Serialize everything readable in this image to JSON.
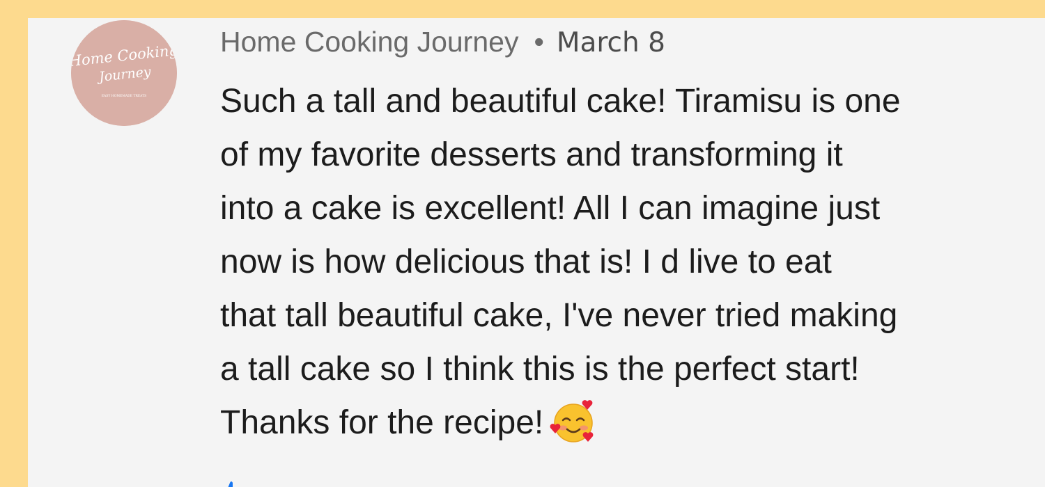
{
  "comment": {
    "author": "Home Cooking Journey",
    "separator": "•",
    "date": "March 8",
    "text_before_emoji": "Such a tall and beautiful cake! Tiramisu is one\nof my favorite desserts and transforming it\ninto a cake is excellent! All I can imagine just\nnow is how delicious that is! I d live to  eat\nthat tall beautiful cake, I've never tried making\na tall cake so I think this is the perfect start!\nThanks for the recipe!",
    "emoji": "smiling-face-with-hearts-icon"
  },
  "avatar": {
    "logo_line1": "Home Cooking",
    "logo_line2": "Journey",
    "logo_tagline": "EASY HOMEMADE TREATS",
    "background_color": "#D9AFA6"
  },
  "colors": {
    "page_background": "#FDDA8E",
    "card_background": "#F4F4F4",
    "meta_text": "#6A6A6A",
    "body_text": "#1C1C1C",
    "like_icon": "#1877F2"
  },
  "icons": {
    "partial_bottom_icon": "like-icon"
  }
}
